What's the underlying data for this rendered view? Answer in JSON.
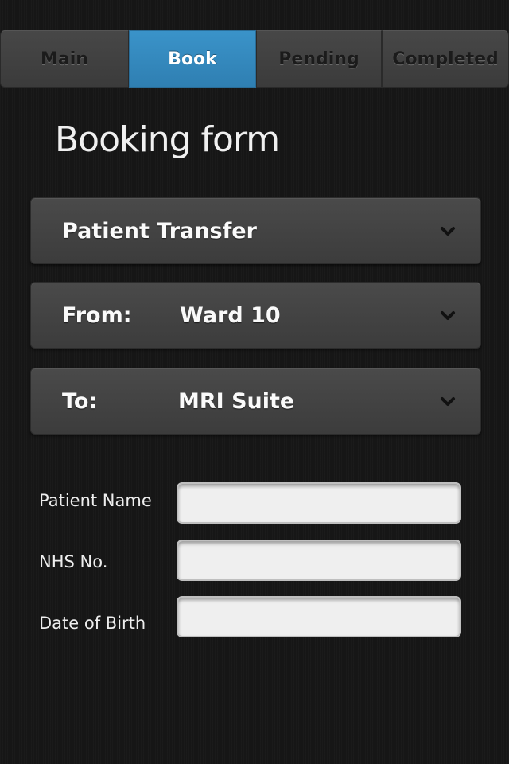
{
  "tabs": [
    {
      "label": "Main",
      "active": false
    },
    {
      "label": "Book",
      "active": true
    },
    {
      "label": "Pending",
      "active": false
    },
    {
      "label": "Completed",
      "active": false
    }
  ],
  "page_title": "Booking form",
  "selects": {
    "service": {
      "value": "Patient Transfer",
      "icon": "chevron-down-icon"
    },
    "from": {
      "label": "From:",
      "value": "Ward 10",
      "icon": "chevron-down-icon"
    },
    "to": {
      "label": "To:",
      "value": "MRI Suite",
      "icon": "chevron-down-icon"
    }
  },
  "fields": {
    "patient_name": {
      "label": "Patient Name",
      "value": "",
      "placeholder": ""
    },
    "nhs_no": {
      "label": "NHS No.",
      "value": "",
      "placeholder": ""
    },
    "dob": {
      "label": "Date of Birth",
      "value": "",
      "placeholder": ""
    }
  },
  "colors": {
    "active_tab": "#2f87bd",
    "background": "#161616",
    "input_background": "#efefef"
  }
}
